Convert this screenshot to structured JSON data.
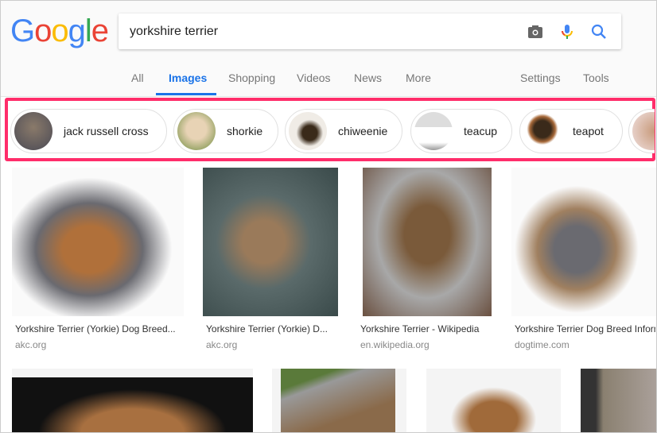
{
  "search": {
    "query": "yorkshire terrier"
  },
  "logo": {
    "text": "Google",
    "colors": [
      "#4285f4",
      "#ea4335",
      "#fbbc05",
      "#4285f4",
      "#34a853",
      "#ea4335"
    ]
  },
  "tabs": [
    {
      "label": "All"
    },
    {
      "label": "Images",
      "active": true
    },
    {
      "label": "Shopping"
    },
    {
      "label": "Videos"
    },
    {
      "label": "News"
    },
    {
      "label": "More"
    }
  ],
  "right_tabs": [
    {
      "label": "Settings"
    },
    {
      "label": "Tools"
    }
  ],
  "highlight_color": "#ff2d6a",
  "chips": [
    {
      "label": "jack russell cross"
    },
    {
      "label": "shorkie"
    },
    {
      "label": "chiweenie"
    },
    {
      "label": "teacup"
    },
    {
      "label": "teapot"
    },
    {
      "label": ""
    }
  ],
  "results": [
    {
      "title": "Yorkshire Terrier (Yorkie) Dog Breed...",
      "domain": "akc.org"
    },
    {
      "title": "Yorkshire Terrier (Yorkie) D...",
      "domain": "akc.org"
    },
    {
      "title": "Yorkshire Terrier - Wikipedia",
      "domain": "en.wikipedia.org"
    },
    {
      "title": "Yorkshire Terrier Dog Breed Information",
      "domain": "dogtime.com"
    }
  ]
}
